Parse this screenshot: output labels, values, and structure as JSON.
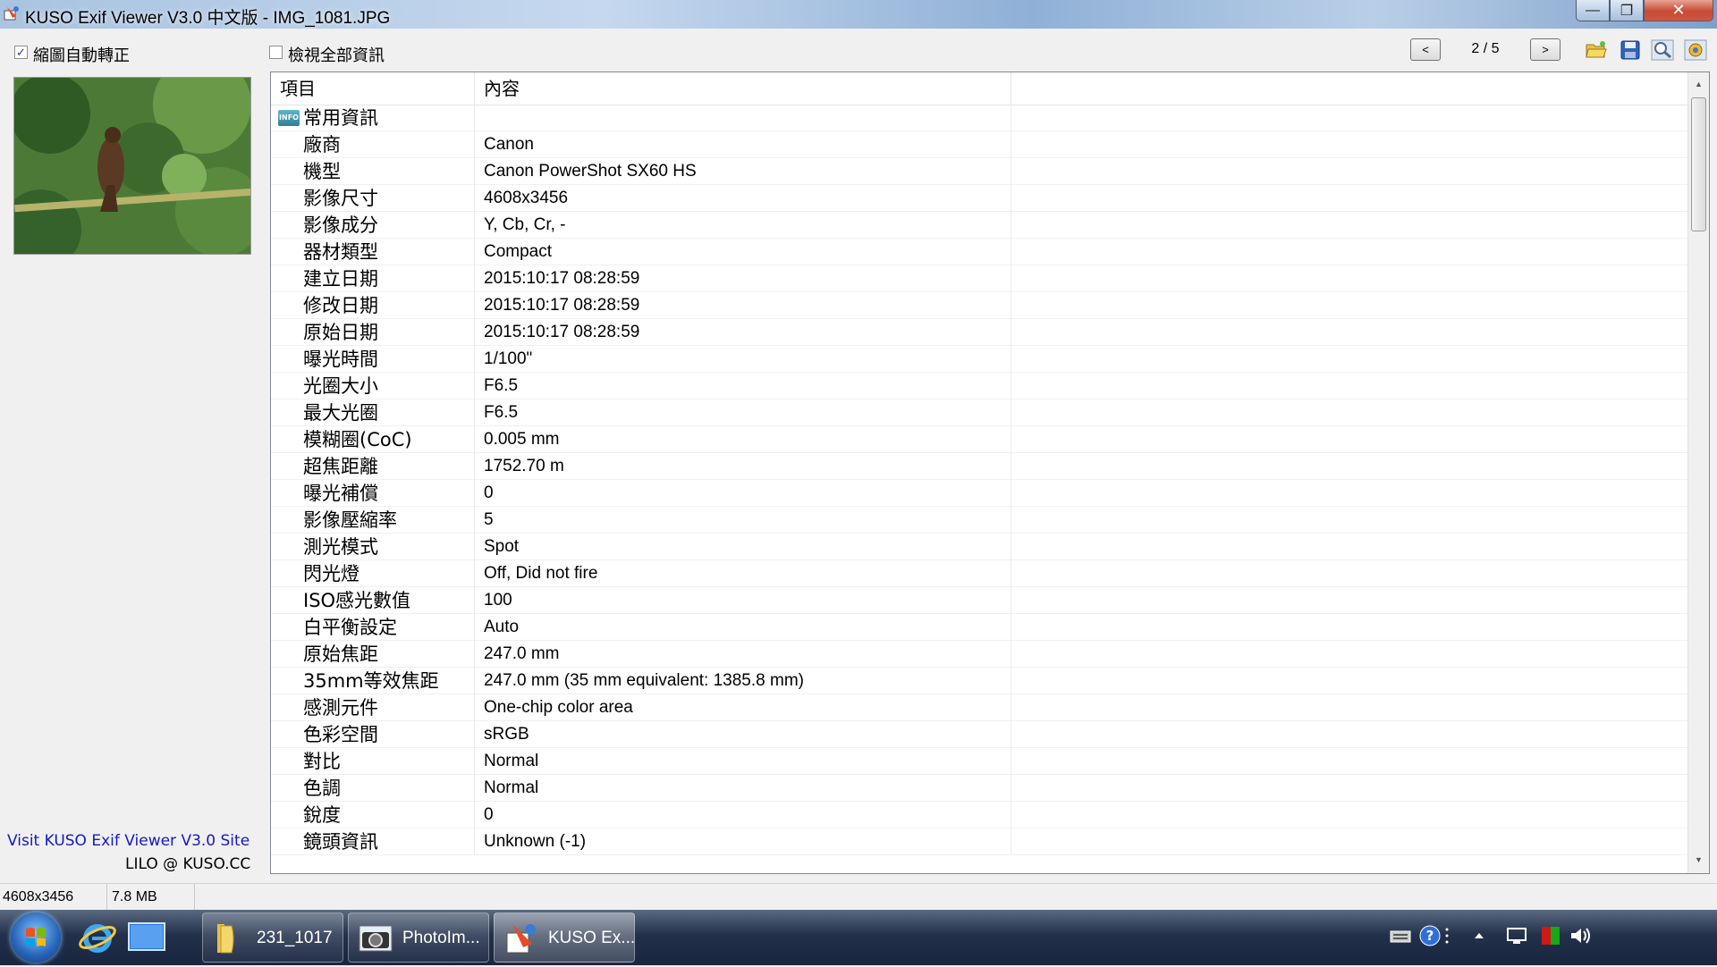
{
  "window": {
    "title": "KUSO Exif Viewer V3.0 中文版 - IMG_1081.JPG",
    "minimize": "—",
    "maximize": "❐",
    "close": "✕"
  },
  "toolbar": {
    "auto_rotate_label": "縮圖自動轉正",
    "auto_rotate_checked": "✓",
    "view_all_label": "檢視全部資訊",
    "prev_label": "<",
    "next_label": ">",
    "page_indicator": "2 / 5"
  },
  "left_panel": {
    "visit_link": "Visit KUSO Exif Viewer V3.0 Site",
    "credit": "LILO @ KUSO.CC"
  },
  "grid": {
    "columns": [
      "項目",
      "內容"
    ],
    "group_label": "常用資訊",
    "group_icon_text": "INFO",
    "rows": [
      {
        "name": "廠商",
        "value": "Canon"
      },
      {
        "name": "機型",
        "value": "Canon PowerShot SX60 HS"
      },
      {
        "name": "影像尺寸",
        "value": "4608x3456"
      },
      {
        "name": "影像成分",
        "value": "Y, Cb, Cr, -"
      },
      {
        "name": "器材類型",
        "value": "Compact"
      },
      {
        "name": "建立日期",
        "value": "2015:10:17 08:28:59"
      },
      {
        "name": "修改日期",
        "value": "2015:10:17 08:28:59"
      },
      {
        "name": "原始日期",
        "value": "2015:10:17 08:28:59"
      },
      {
        "name": "曝光時間",
        "value": "1/100\""
      },
      {
        "name": "光圈大小",
        "value": "F6.5"
      },
      {
        "name": "最大光圈",
        "value": "F6.5"
      },
      {
        "name": "模糊圈(CoC)",
        "value": "0.005 mm"
      },
      {
        "name": "超焦距離",
        "value": "1752.70 m"
      },
      {
        "name": "曝光補償",
        "value": "0"
      },
      {
        "name": "影像壓縮率",
        "value": "5"
      },
      {
        "name": "測光模式",
        "value": "Spot"
      },
      {
        "name": "閃光燈",
        "value": "Off, Did not fire"
      },
      {
        "name": "ISO感光數值",
        "value": "100"
      },
      {
        "name": "白平衡設定",
        "value": "Auto"
      },
      {
        "name": "原始焦距",
        "value": "247.0 mm"
      },
      {
        "name": "35mm等效焦距",
        "value": "247.0 mm (35 mm equivalent: 1385.8 mm)"
      },
      {
        "name": "感測元件",
        "value": "One-chip color area"
      },
      {
        "name": "色彩空間",
        "value": "sRGB"
      },
      {
        "name": "對比",
        "value": "Normal"
      },
      {
        "name": "色調",
        "value": "Normal"
      },
      {
        "name": "銳度",
        "value": "0"
      },
      {
        "name": "鏡頭資訊",
        "value": "Unknown (-1)"
      }
    ]
  },
  "status": {
    "dimensions": "4608x3456",
    "filesize": "7.8 MB"
  },
  "taskbar": {
    "items": [
      {
        "label": "231_1017",
        "icon": "folder-icon"
      },
      {
        "label": "PhotoIm...",
        "icon": "camera-icon"
      },
      {
        "label": "KUSO Ex...",
        "icon": "kuso-app-icon"
      }
    ]
  },
  "colors": {
    "link": "#1717c5",
    "close_red": "#c74a32",
    "taskbar": "#22304a"
  }
}
